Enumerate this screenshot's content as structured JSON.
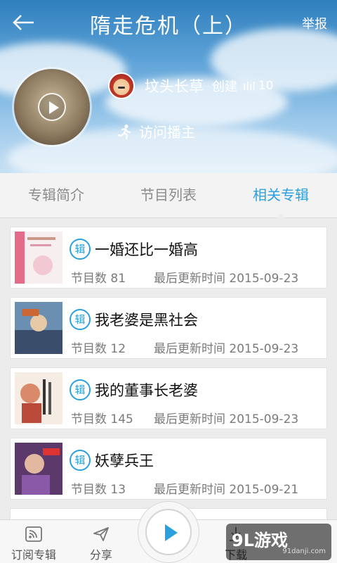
{
  "header": {
    "title": "隋走危机（上）",
    "report_label": "举报",
    "back_icon": "arrow-left-icon"
  },
  "creator": {
    "name": "坟头长草",
    "created_label": "创建",
    "wave_icon": "audio-wave-icon",
    "count": "10"
  },
  "visit": {
    "label": "访问播主",
    "icon": "running-person-icon"
  },
  "tabs": [
    {
      "label": "专辑简介",
      "active": false
    },
    {
      "label": "节目列表",
      "active": false
    },
    {
      "label": "相关专辑",
      "active": true
    }
  ],
  "albums": [
    {
      "badge": "辑",
      "title": "一婚还比一婚高",
      "count": "节目数 81",
      "updated": "最后更新时间 2015-09-23"
    },
    {
      "badge": "辑",
      "title": "我老婆是黑社会",
      "count": "节目数 12",
      "updated": "最后更新时间 2015-09-23"
    },
    {
      "badge": "辑",
      "title": "我的董事长老婆",
      "count": "节目数 145",
      "updated": "最后更新时间 2015-09-23"
    },
    {
      "badge": "辑",
      "title": "妖孽兵王",
      "count": "节目数 13",
      "updated": "最后更新时间 2015-09-21"
    }
  ],
  "bottom_nav": {
    "subscribe": "订阅专辑",
    "share": "分享",
    "download": "下载"
  },
  "watermark": {
    "main": "9L游戏",
    "sub": "91danji.com"
  },
  "colors": {
    "accent": "#2aa0de",
    "text": "#111111",
    "meta": "#7a7a7a"
  }
}
